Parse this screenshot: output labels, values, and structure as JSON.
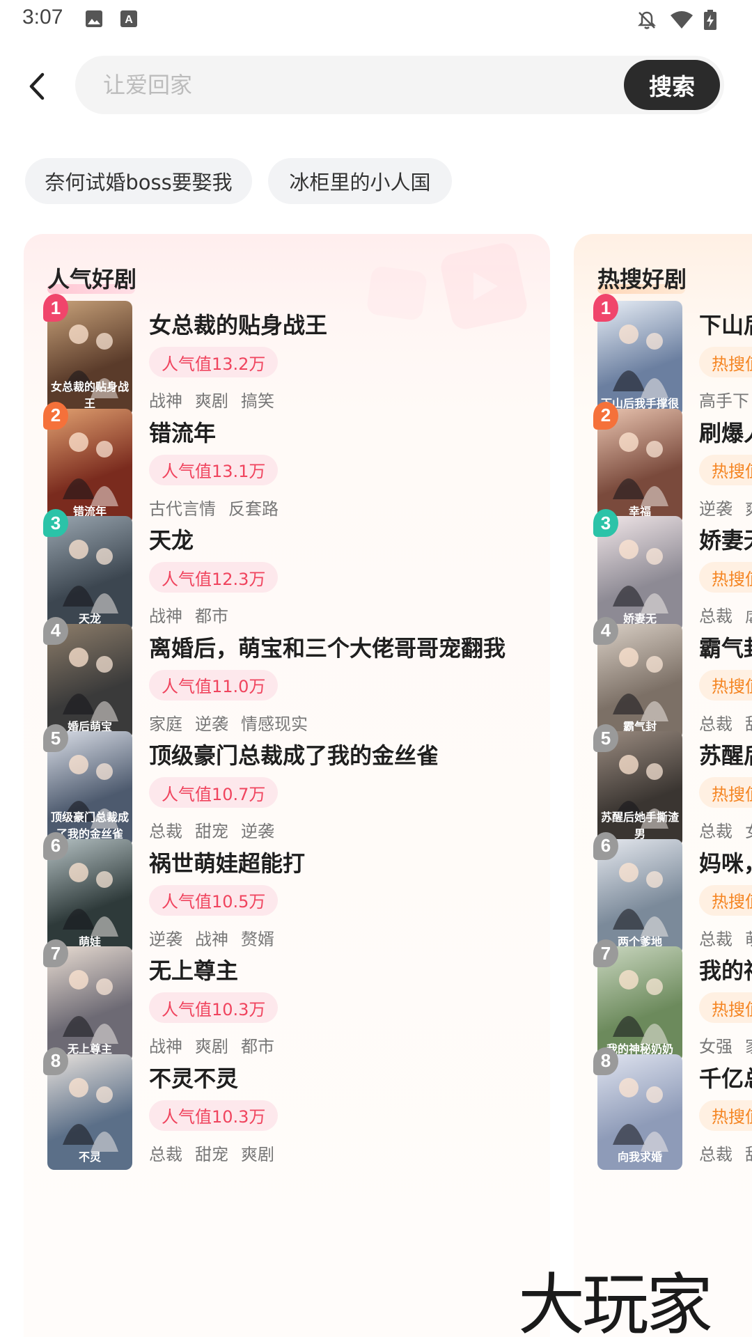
{
  "status_bar": {
    "time": "3:07"
  },
  "search": {
    "placeholder": "让爱回家",
    "button_label": "搜索"
  },
  "history": [
    "奈何试婚boss要娶我",
    "冰柜里的小人国"
  ],
  "popular_panel": {
    "title": "人气好剧",
    "items": [
      {
        "rank": "1",
        "title": "女总裁的贴身战王",
        "score": "人气值13.2万",
        "genres": [
          "战神",
          "爽剧",
          "搞笑"
        ],
        "cover_text": "女总裁的贴身战王"
      },
      {
        "rank": "2",
        "title": "错流年",
        "score": "人气值13.1万",
        "genres": [
          "古代言情",
          "反套路"
        ],
        "cover_text": "错流年"
      },
      {
        "rank": "3",
        "title": "天龙",
        "score": "人气值12.3万",
        "genres": [
          "战神",
          "都市"
        ],
        "cover_text": "天龙"
      },
      {
        "rank": "4",
        "title": "离婚后，萌宝和三个大佬哥哥宠翻我",
        "score": "人气值11.0万",
        "genres": [
          "家庭",
          "逆袭",
          "情感现实"
        ],
        "cover_text": "婚后萌宝"
      },
      {
        "rank": "5",
        "title": "顶级豪门总裁成了我的金丝雀",
        "score": "人气值10.7万",
        "genres": [
          "总裁",
          "甜宠",
          "逆袭"
        ],
        "cover_text": "顶级豪门总裁成了我的金丝雀"
      },
      {
        "rank": "6",
        "title": "祸世萌娃超能打",
        "score": "人气值10.5万",
        "genres": [
          "逆袭",
          "战神",
          "赘婿"
        ],
        "cover_text": "萌娃"
      },
      {
        "rank": "7",
        "title": "无上尊主",
        "score": "人气值10.3万",
        "genres": [
          "战神",
          "爽剧",
          "都市"
        ],
        "cover_text": "无上尊主"
      },
      {
        "rank": "8",
        "title": "不灵不灵",
        "score": "人气值10.3万",
        "genres": [
          "总裁",
          "甜宠",
          "爽剧"
        ],
        "cover_text": "不灵"
      }
    ]
  },
  "hot_panel": {
    "title": "热搜好剧",
    "items": [
      {
        "rank": "1",
        "title": "下山后",
        "score": "热搜值",
        "genres": [
          "高手下"
        ],
        "cover_text": "下山后我手撑很"
      },
      {
        "rank": "2",
        "title": "刷爆人",
        "score": "热搜值",
        "genres": [
          "逆袭",
          "爽"
        ],
        "cover_text": "幸福"
      },
      {
        "rank": "3",
        "title": "娇妻无",
        "score": "热搜值",
        "genres": [
          "总裁",
          "虐"
        ],
        "cover_text": "娇妻无"
      },
      {
        "rank": "4",
        "title": "霸气封",
        "score": "热搜值",
        "genres": [
          "总裁",
          "甜"
        ],
        "cover_text": "霸气封"
      },
      {
        "rank": "5",
        "title": "苏醒后",
        "score": "热搜值",
        "genres": [
          "总裁",
          "女"
        ],
        "cover_text": "苏醒后她手撕渣男"
      },
      {
        "rank": "6",
        "title": "妈咪，",
        "score": "热搜值",
        "genres": [
          "总裁",
          "萌"
        ],
        "cover_text": "两个爹地"
      },
      {
        "rank": "7",
        "title": "我的神",
        "score": "热搜值",
        "genres": [
          "女强",
          "家"
        ],
        "cover_text": "我的神秘奶奶"
      },
      {
        "rank": "8",
        "title": "千亿总",
        "score": "热搜值",
        "genres": [
          "总裁",
          "甜"
        ],
        "cover_text": "向我求婚"
      }
    ]
  },
  "watermark": "大玩家",
  "colors": {
    "rank1": "#f0456b",
    "rank2": "#f5713a",
    "rank3": "#2bc3a8",
    "rank_other": "#9a9a9a",
    "popular_accent": "#f0445e",
    "hot_accent": "#f58522"
  }
}
